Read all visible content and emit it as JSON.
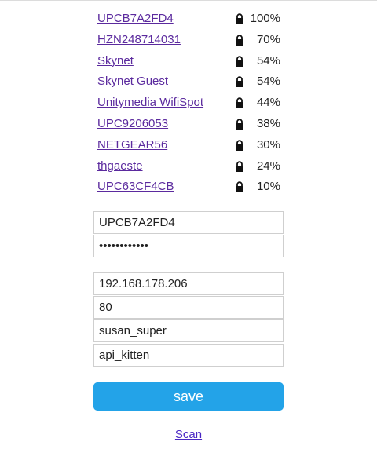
{
  "networks": [
    {
      "ssid": "UPCB7A2FD4",
      "signal": "100%",
      "locked": true
    },
    {
      "ssid": "HZN248714031",
      "signal": "70%",
      "locked": true
    },
    {
      "ssid": "Skynet",
      "signal": "54%",
      "locked": true
    },
    {
      "ssid": "Skynet Guest",
      "signal": "54%",
      "locked": true
    },
    {
      "ssid": "Unitymedia WifiSpot",
      "signal": "44%",
      "locked": true
    },
    {
      "ssid": "UPC9206053",
      "signal": "38%",
      "locked": true
    },
    {
      "ssid": "NETGEAR56",
      "signal": "30%",
      "locked": true
    },
    {
      "ssid": "thgaeste",
      "signal": "24%",
      "locked": true
    },
    {
      "ssid": "UPC63CF4CB",
      "signal": "10%",
      "locked": true
    }
  ],
  "wifi": {
    "ssid_value": "UPCB7A2FD4",
    "password_value": "••••••••••••"
  },
  "server": {
    "host_value": "192.168.178.206",
    "port_value": "80",
    "user_value": "susan_super",
    "key_value": "api_kitten"
  },
  "actions": {
    "save_label": "save",
    "scan_label": "Scan"
  },
  "icons": {
    "lock": "lock-icon"
  },
  "colors": {
    "link": "#5b2a9e",
    "save_button": "#23a3e8",
    "scan_link": "#4a27c4"
  }
}
